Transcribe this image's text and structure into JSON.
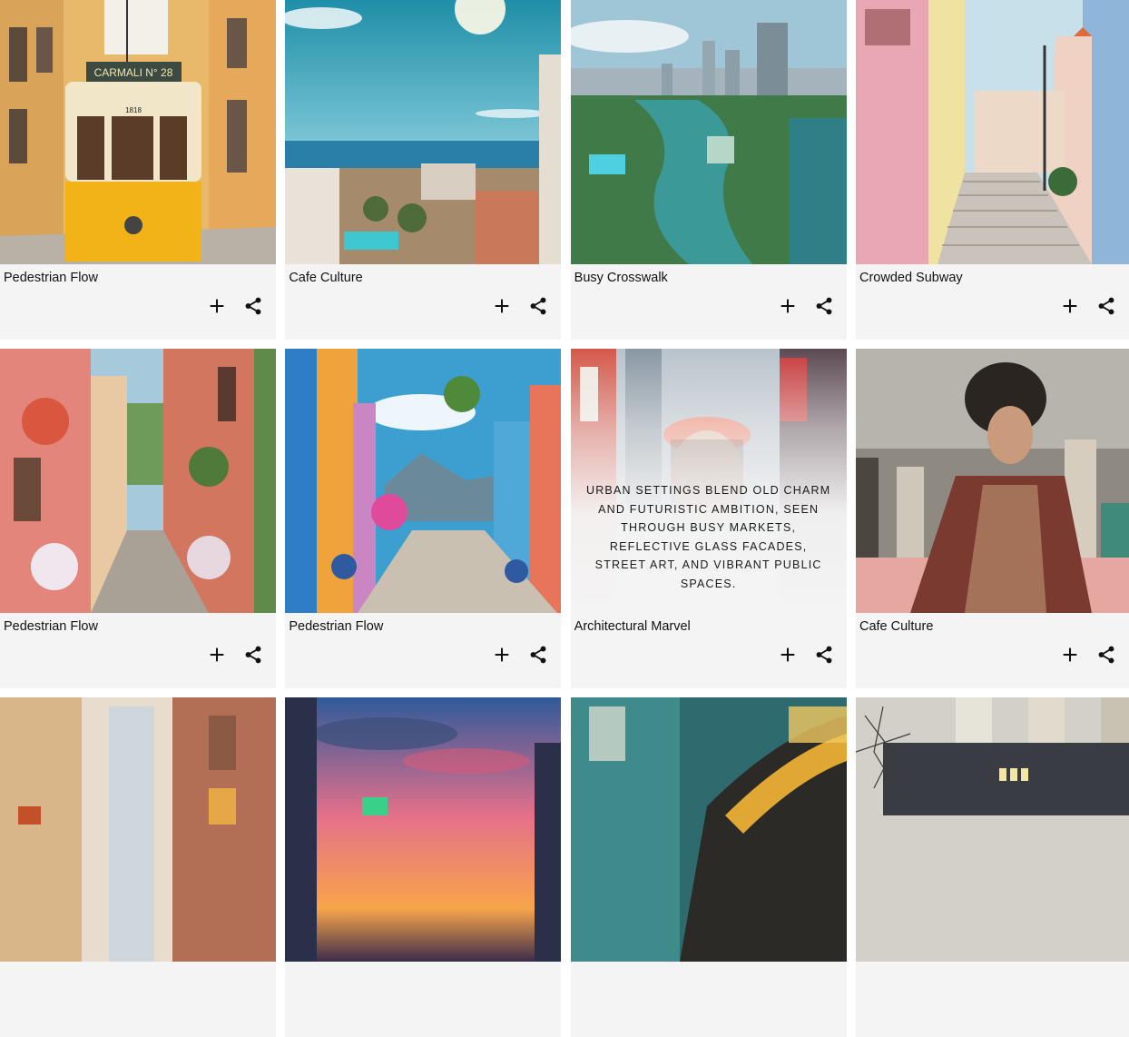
{
  "gallery": {
    "cards": [
      {
        "title": "Pedestrian Flow"
      },
      {
        "title": "Cafe Culture"
      },
      {
        "title": "Busy Crosswalk"
      },
      {
        "title": "Crowded Subway"
      },
      {
        "title": "Pedestrian Flow"
      },
      {
        "title": "Pedestrian Flow"
      },
      {
        "title": "Architectural Marvel",
        "hover_text": "Urban settings blend old charm and futuristic ambition, seen through busy markets, reflective glass facades, street art, and vibrant public spaces."
      },
      {
        "title": "Cafe Culture"
      },
      {
        "title": ""
      },
      {
        "title": ""
      },
      {
        "title": ""
      },
      {
        "title": ""
      }
    ],
    "tram_sign": "CARMALI  N° 28",
    "tram_number": "1818",
    "icons": {
      "add": "plus-icon",
      "share": "share-icon"
    }
  }
}
